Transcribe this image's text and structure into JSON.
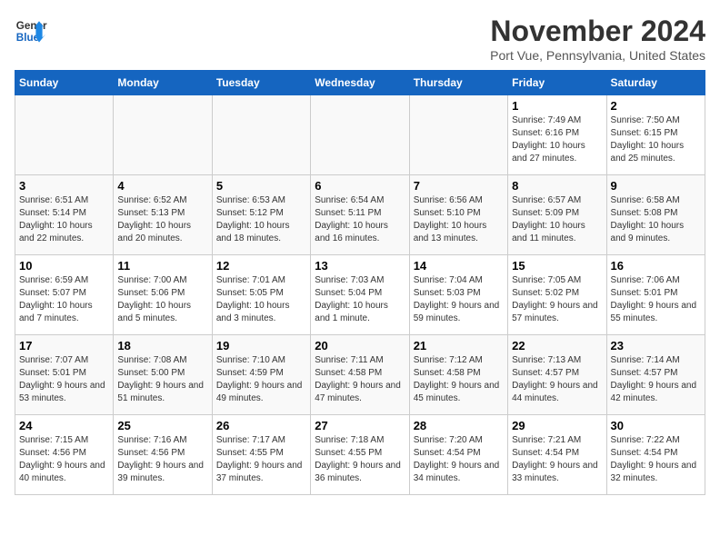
{
  "logo": {
    "line1": "General",
    "line2": "Blue"
  },
  "title": "November 2024",
  "subtitle": "Port Vue, Pennsylvania, United States",
  "days_of_week": [
    "Sunday",
    "Monday",
    "Tuesday",
    "Wednesday",
    "Thursday",
    "Friday",
    "Saturday"
  ],
  "weeks": [
    [
      {
        "day": "",
        "info": ""
      },
      {
        "day": "",
        "info": ""
      },
      {
        "day": "",
        "info": ""
      },
      {
        "day": "",
        "info": ""
      },
      {
        "day": "",
        "info": ""
      },
      {
        "day": "1",
        "info": "Sunrise: 7:49 AM\nSunset: 6:16 PM\nDaylight: 10 hours and 27 minutes."
      },
      {
        "day": "2",
        "info": "Sunrise: 7:50 AM\nSunset: 6:15 PM\nDaylight: 10 hours and 25 minutes."
      }
    ],
    [
      {
        "day": "3",
        "info": "Sunrise: 6:51 AM\nSunset: 5:14 PM\nDaylight: 10 hours and 22 minutes."
      },
      {
        "day": "4",
        "info": "Sunrise: 6:52 AM\nSunset: 5:13 PM\nDaylight: 10 hours and 20 minutes."
      },
      {
        "day": "5",
        "info": "Sunrise: 6:53 AM\nSunset: 5:12 PM\nDaylight: 10 hours and 18 minutes."
      },
      {
        "day": "6",
        "info": "Sunrise: 6:54 AM\nSunset: 5:11 PM\nDaylight: 10 hours and 16 minutes."
      },
      {
        "day": "7",
        "info": "Sunrise: 6:56 AM\nSunset: 5:10 PM\nDaylight: 10 hours and 13 minutes."
      },
      {
        "day": "8",
        "info": "Sunrise: 6:57 AM\nSunset: 5:09 PM\nDaylight: 10 hours and 11 minutes."
      },
      {
        "day": "9",
        "info": "Sunrise: 6:58 AM\nSunset: 5:08 PM\nDaylight: 10 hours and 9 minutes."
      }
    ],
    [
      {
        "day": "10",
        "info": "Sunrise: 6:59 AM\nSunset: 5:07 PM\nDaylight: 10 hours and 7 minutes."
      },
      {
        "day": "11",
        "info": "Sunrise: 7:00 AM\nSunset: 5:06 PM\nDaylight: 10 hours and 5 minutes."
      },
      {
        "day": "12",
        "info": "Sunrise: 7:01 AM\nSunset: 5:05 PM\nDaylight: 10 hours and 3 minutes."
      },
      {
        "day": "13",
        "info": "Sunrise: 7:03 AM\nSunset: 5:04 PM\nDaylight: 10 hours and 1 minute."
      },
      {
        "day": "14",
        "info": "Sunrise: 7:04 AM\nSunset: 5:03 PM\nDaylight: 9 hours and 59 minutes."
      },
      {
        "day": "15",
        "info": "Sunrise: 7:05 AM\nSunset: 5:02 PM\nDaylight: 9 hours and 57 minutes."
      },
      {
        "day": "16",
        "info": "Sunrise: 7:06 AM\nSunset: 5:01 PM\nDaylight: 9 hours and 55 minutes."
      }
    ],
    [
      {
        "day": "17",
        "info": "Sunrise: 7:07 AM\nSunset: 5:01 PM\nDaylight: 9 hours and 53 minutes."
      },
      {
        "day": "18",
        "info": "Sunrise: 7:08 AM\nSunset: 5:00 PM\nDaylight: 9 hours and 51 minutes."
      },
      {
        "day": "19",
        "info": "Sunrise: 7:10 AM\nSunset: 4:59 PM\nDaylight: 9 hours and 49 minutes."
      },
      {
        "day": "20",
        "info": "Sunrise: 7:11 AM\nSunset: 4:58 PM\nDaylight: 9 hours and 47 minutes."
      },
      {
        "day": "21",
        "info": "Sunrise: 7:12 AM\nSunset: 4:58 PM\nDaylight: 9 hours and 45 minutes."
      },
      {
        "day": "22",
        "info": "Sunrise: 7:13 AM\nSunset: 4:57 PM\nDaylight: 9 hours and 44 minutes."
      },
      {
        "day": "23",
        "info": "Sunrise: 7:14 AM\nSunset: 4:57 PM\nDaylight: 9 hours and 42 minutes."
      }
    ],
    [
      {
        "day": "24",
        "info": "Sunrise: 7:15 AM\nSunset: 4:56 PM\nDaylight: 9 hours and 40 minutes."
      },
      {
        "day": "25",
        "info": "Sunrise: 7:16 AM\nSunset: 4:56 PM\nDaylight: 9 hours and 39 minutes."
      },
      {
        "day": "26",
        "info": "Sunrise: 7:17 AM\nSunset: 4:55 PM\nDaylight: 9 hours and 37 minutes."
      },
      {
        "day": "27",
        "info": "Sunrise: 7:18 AM\nSunset: 4:55 PM\nDaylight: 9 hours and 36 minutes."
      },
      {
        "day": "28",
        "info": "Sunrise: 7:20 AM\nSunset: 4:54 PM\nDaylight: 9 hours and 34 minutes."
      },
      {
        "day": "29",
        "info": "Sunrise: 7:21 AM\nSunset: 4:54 PM\nDaylight: 9 hours and 33 minutes."
      },
      {
        "day": "30",
        "info": "Sunrise: 7:22 AM\nSunset: 4:54 PM\nDaylight: 9 hours and 32 minutes."
      }
    ]
  ]
}
